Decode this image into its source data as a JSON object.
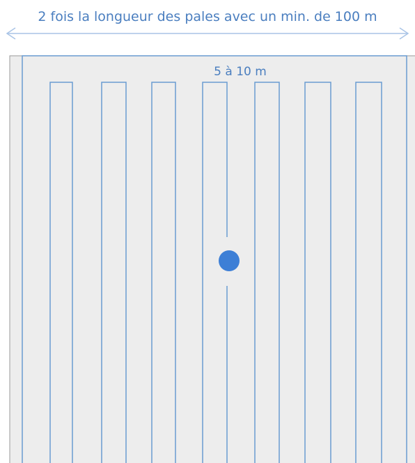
{
  "diagram": {
    "width_label": "2 fois la longueur des pales avec un min. de 100 m",
    "spacing_label": "5 à 10 m",
    "colors": {
      "line": "#6a9bd1",
      "area_fill": "#ededed",
      "area_border": "#9a9a9a",
      "marker": "#3d7fd6",
      "text": "#4a7ebf",
      "arrow": "#a9c4e6"
    },
    "pass_count": 7,
    "center_marker": "turbine-position-dot"
  }
}
